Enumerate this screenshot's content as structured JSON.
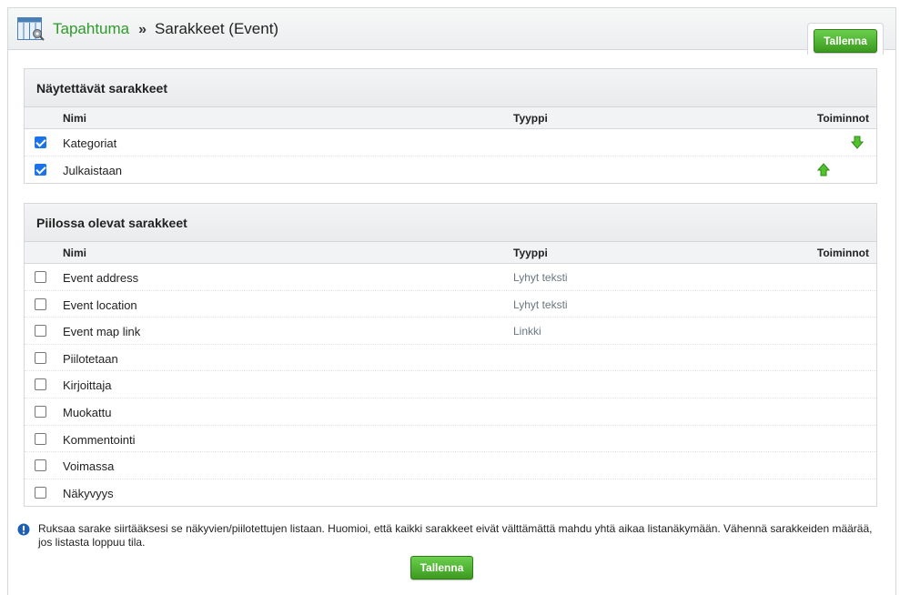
{
  "header": {
    "breadcrumb_root": "Tapahtuma",
    "breadcrumb_separator": "»",
    "breadcrumb_current": "Sarakkeet (Event)",
    "app_icon": "columns-settings-icon"
  },
  "actions": {
    "save_label": "Tallenna"
  },
  "columns_header": {
    "name": "Nimi",
    "type": "Tyyppi",
    "actions": "Toiminnot"
  },
  "visible_panel": {
    "title": "Näytettävät sarakkeet",
    "rows": [
      {
        "name": "Kategoriat",
        "type": "",
        "checked": true,
        "action": "move-down"
      },
      {
        "name": "Julkaistaan",
        "type": "",
        "checked": true,
        "action": "move-up"
      }
    ]
  },
  "hidden_panel": {
    "title": "Piilossa olevat sarakkeet",
    "rows": [
      {
        "name": "Event address",
        "type": "Lyhyt teksti",
        "checked": false
      },
      {
        "name": "Event location",
        "type": "Lyhyt teksti",
        "checked": false
      },
      {
        "name": "Event map link",
        "type": "Linkki",
        "checked": false
      },
      {
        "name": "Piilotetaan",
        "type": "",
        "checked": false
      },
      {
        "name": "Kirjoittaja",
        "type": "",
        "checked": false
      },
      {
        "name": "Muokattu",
        "type": "",
        "checked": false
      },
      {
        "name": "Kommentointi",
        "type": "",
        "checked": false
      },
      {
        "name": "Voimassa",
        "type": "",
        "checked": false
      },
      {
        "name": "Näkyvyys",
        "type": "",
        "checked": false
      }
    ]
  },
  "hint": {
    "icon": "info-icon",
    "text": "Ruksaa sarake siirtääksesi se näkyvien/piilotettujen listaan. Huomioi, että kaikki sarakkeet eivät välttämättä mahdu yhtä aikaa listanäkymään. Vähennä sarakkeiden määrää, jos listasta loppuu tila."
  },
  "colors": {
    "accent_green": "#2f9a2a",
    "button_green": "#4caf2c",
    "checkbox_blue": "#1a73e8",
    "type_text": "#6a7780"
  }
}
